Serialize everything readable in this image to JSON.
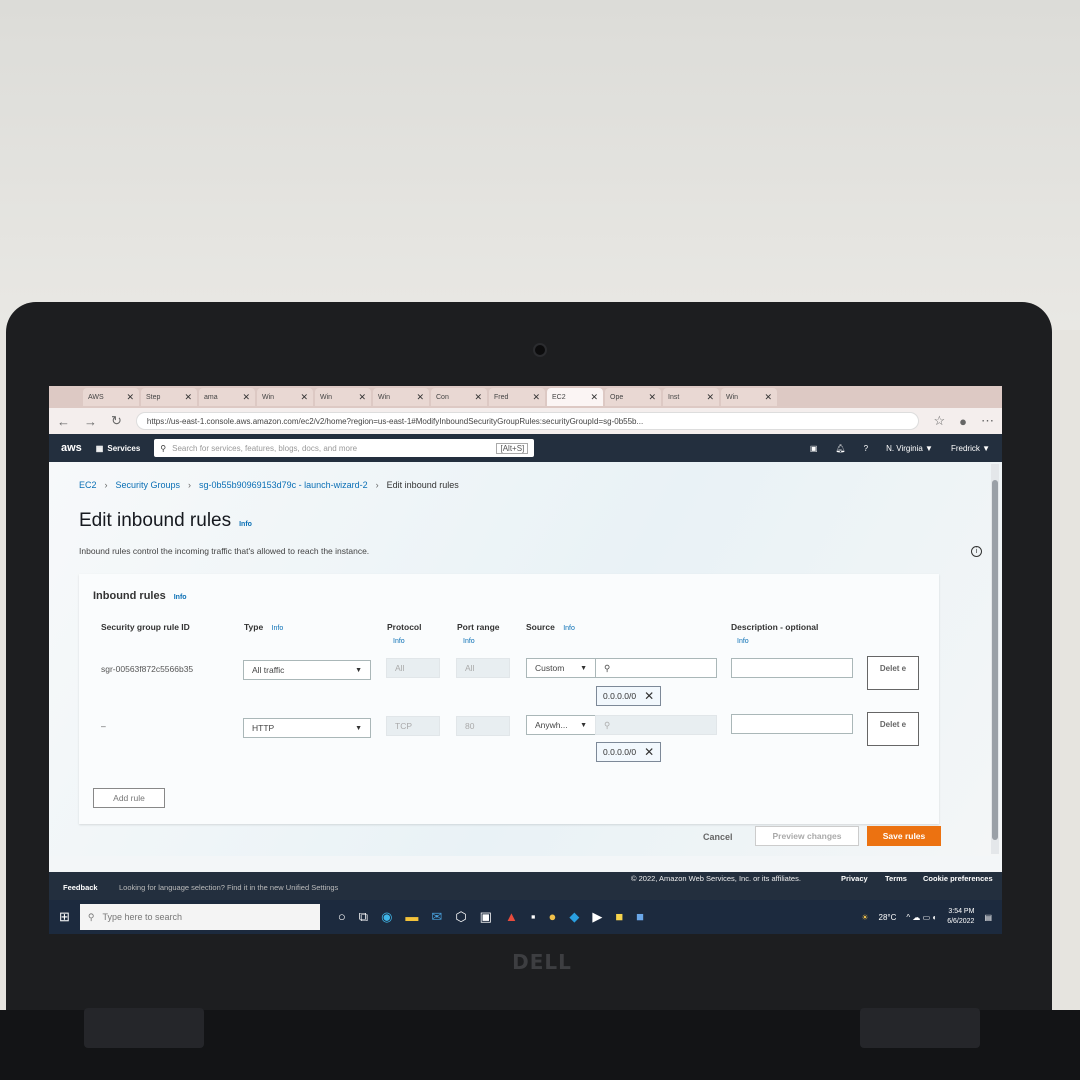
{
  "browser": {
    "tabs": [
      {
        "label": "AWS",
        "active": false
      },
      {
        "label": "Step",
        "active": false
      },
      {
        "label": "ama",
        "active": false
      },
      {
        "label": "Win",
        "active": false
      },
      {
        "label": "Win",
        "active": false
      },
      {
        "label": "Win",
        "active": false
      },
      {
        "label": "Con",
        "active": false
      },
      {
        "label": "Fred",
        "active": false
      },
      {
        "label": "EC2",
        "active": true
      },
      {
        "label": "Ope",
        "active": false
      },
      {
        "label": "Inst",
        "active": false
      },
      {
        "label": "Win",
        "active": false
      }
    ],
    "url": "https://us-east-1.console.aws.amazon.com/ec2/v2/home?region=us-east-1#ModifyInboundSecurityGroupRules:securityGroupId=sg-0b55b..."
  },
  "awsnav": {
    "logo": "aws",
    "services": "Services",
    "search_placeholder": "Search for services, features, blogs, docs, and more",
    "shortcut": "[Alt+S]",
    "region": "N. Virginia ▼",
    "user": "Fredrick ▼"
  },
  "breadcrumb": {
    "ec2": "EC2",
    "security_groups": "Security Groups",
    "group": "sg-0b55b90969153d79c - launch-wizard-2",
    "current": "Edit inbound rules"
  },
  "page": {
    "title": "Edit inbound rules",
    "info": "Info",
    "description": "Inbound rules control the incoming traffic that's allowed to reach the instance."
  },
  "panel": {
    "title": "Inbound rules",
    "info": "Info",
    "columns": {
      "rule_id": "Security group rule ID",
      "type": "Type",
      "protocol": "Protocol",
      "port_range": "Port range",
      "source": "Source",
      "description": "Description - optional",
      "info": "Info"
    },
    "rows": [
      {
        "rule_id": "sgr-00563f872c5566b35",
        "type": "All traffic",
        "protocol": "All",
        "port": "All",
        "source": "Custom",
        "cidr": "0.0.0.0/0",
        "delete": "Delet e"
      },
      {
        "rule_id": "–",
        "type": "HTTP",
        "protocol": "TCP",
        "port": "80",
        "source": "Anywh...",
        "cidr": "0.0.0.0/0",
        "delete": "Delet e"
      }
    ],
    "add_rule": "Add rule"
  },
  "actions": {
    "cancel": "Cancel",
    "preview": "Preview changes",
    "save": "Save rules"
  },
  "footer": {
    "feedback": "Feedback",
    "language": "Looking for language selection? Find it in the new Unified Settings",
    "copyright": "© 2022, Amazon Web Services, Inc. or its affiliates.",
    "privacy": "Privacy",
    "terms": "Terms",
    "cookie": "Cookie preferences"
  },
  "taskbar": {
    "search_placeholder": "Type here to search",
    "temperature": "28°C",
    "time": "3:54 PM",
    "date": "6/6/2022"
  },
  "device": {
    "brand": "DELL"
  },
  "colors": {
    "aws_nav": "#232f3e",
    "save_button": "#ec7211",
    "link": "#0a6fb5"
  }
}
